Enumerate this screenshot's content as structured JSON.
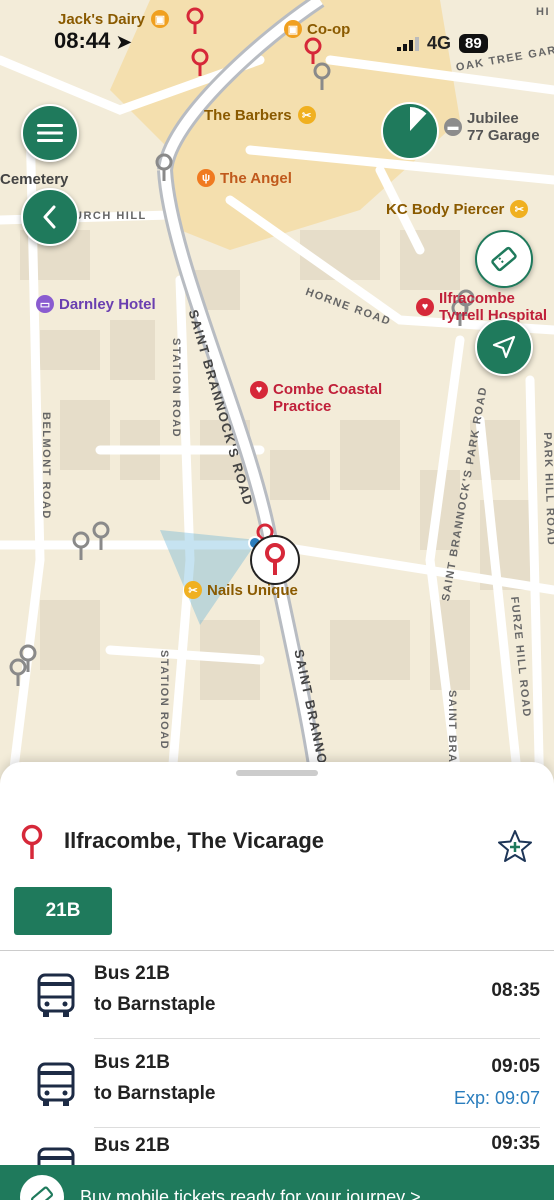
{
  "status_bar": {
    "time": "08:44",
    "network": "4G",
    "battery": "89"
  },
  "map": {
    "pois": {
      "jacks_dairy": "Jack's Dairy",
      "coop": "Co-op",
      "barbers": "The Barbers",
      "jubilee": "Jubilee\n77 Garage",
      "cemetery": "Cemetery",
      "angel": "The Angel",
      "kc_body": "KC Body Piercer",
      "darnley": "Darnley Hotel",
      "hospital": "Ilfracombe\nTyrrell Hospital",
      "combe_coastal": "Combe Coastal\nPractice",
      "nails": "Nails Unique"
    },
    "streets": {
      "oak_tree": "OAK TREE GARD",
      "church_hill": "URCH HILL",
      "horne_road": "HORNE ROAD",
      "saint_brannocks_road": "SAINT BRANNOCK'S ROAD",
      "station_road_1": "STATION ROAD",
      "station_road_2": "STATION ROAD",
      "belmont_road": "BELMONT ROAD",
      "saint_brannocks_park": "SAINT BRANNOCK'S PARK ROAD",
      "saint_brannock_lower": "SAINT BRANNO",
      "saint_bran_right": "SAINT BRAN",
      "furze_hill": "FURZE HILL ROAD",
      "park_hill": "PARK HILL ROAD",
      "hi": "HI"
    },
    "timer_fraction": 0.12
  },
  "controls": {
    "menu_icon": "hamburger-menu-icon",
    "back_icon": "chevron-left-icon",
    "ticket_icon": "ticket-icon",
    "locate_icon": "location-arrow-icon"
  },
  "stop": {
    "name": "Ilfracombe, The Vicarage",
    "favourite_icon": "star-plus-icon",
    "route_filter": "21B"
  },
  "departures": [
    {
      "line1": "Bus 21B",
      "line2": "to Barnstaple",
      "time": "08:35",
      "expected": ""
    },
    {
      "line1": "Bus 21B",
      "line2": "to Barnstaple",
      "time": "09:05",
      "expected": "Exp: 09:07"
    },
    {
      "line1": "Bus 21B",
      "line2": "",
      "time": "09:35",
      "expected": ""
    }
  ],
  "banner": {
    "text": "Buy mobile tickets ready for your journey >"
  },
  "colors": {
    "brand_green": "#1f7a5c",
    "stop_red": "#d62839",
    "expected_blue": "#2a7dbd"
  }
}
